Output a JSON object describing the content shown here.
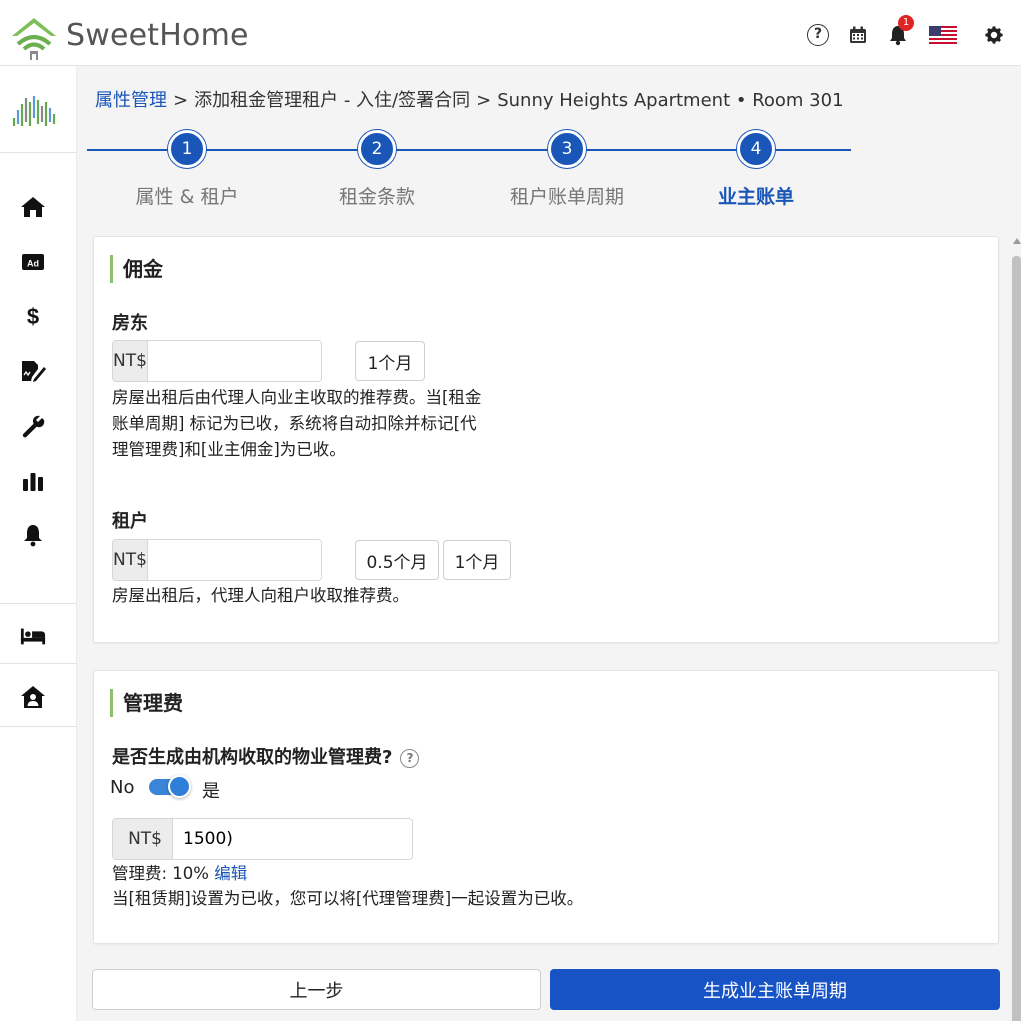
{
  "app": {
    "brand": "SweetHome"
  },
  "topbar": {
    "notification_count": "1",
    "help_glyph": "?"
  },
  "breadcrumb": {
    "items": [
      {
        "label": "属性管理"
      },
      {
        "label": "添加租金管理租户 - 入住/签署合同"
      },
      {
        "label": "Sunny Heights Apartment • Room 301"
      }
    ]
  },
  "stepper": {
    "steps": [
      {
        "number": "1",
        "label": "属性 & 租户"
      },
      {
        "number": "2",
        "label": "租金条款"
      },
      {
        "number": "3",
        "label": "租户账单周期"
      },
      {
        "number": "4",
        "label": "业主账单"
      }
    ],
    "active_step": 4
  },
  "commission": {
    "title": "佣金",
    "landlord": {
      "label": "房东",
      "currency": "NT$",
      "value": "",
      "options": [
        "1个月"
      ],
      "description_lines": [
        "房屋出租后由代理人向业主收取的推荐费。当[租金",
        "账单周期] 标记为已收，系统将自动扣除并标记[代",
        "理管理费]和[业主佣金]为已收。"
      ]
    },
    "tenant": {
      "label": "租户",
      "currency": "NT$",
      "value": "",
      "options": [
        "0.5个月",
        "1个月"
      ],
      "description": "房屋出租后，代理人向租户收取推荐费。"
    }
  },
  "management_fee": {
    "title": "管理费",
    "question": "是否生成由机构收取的物业管理费?",
    "toggle_off_label": "No",
    "toggle_on_label": "是",
    "toggle_on": true,
    "currency": "NT$",
    "amount": "1500)",
    "fee_label": "管理费: 10%",
    "edit_link": "编辑",
    "note": "当[租赁期]设置为已收，您可以将[代理管理费]一起设置为已收。"
  },
  "actions": {
    "prev_label": "上一步",
    "next_label": "生成业主账单周期"
  },
  "colors": {
    "primary": "#1a56b8",
    "accent_green": "#8cc06a",
    "badge_red": "#e02424"
  },
  "icons": {
    "sidebar": [
      "home-icon",
      "ad-icon",
      "dollar-icon",
      "contract-sign-icon",
      "wrench-icon",
      "bar-chart-icon",
      "bell-icon",
      "bed-icon",
      "house-user-icon"
    ],
    "topbar": [
      "help-icon",
      "calendar-icon",
      "bell-icon",
      "us-flag-icon",
      "gear-icon"
    ]
  }
}
